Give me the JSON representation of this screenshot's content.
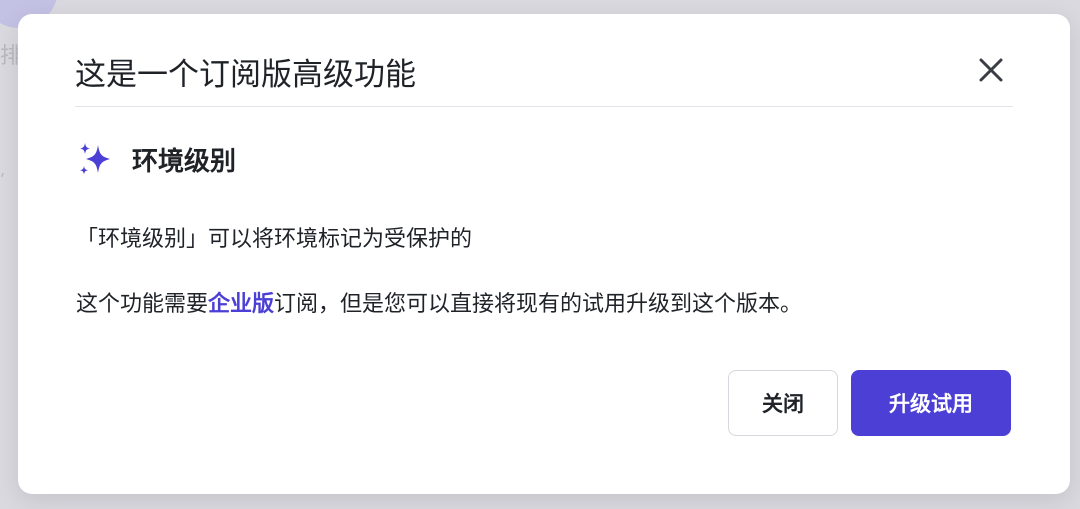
{
  "background": {
    "partial_text": "排",
    "partial_mark": ","
  },
  "dialog": {
    "title": "这是一个订阅版高级功能",
    "close_icon": "close-icon",
    "feature": {
      "icon": "sparkle-icon",
      "name": "环境级别"
    },
    "description": "「环境级别」可以将环境标记为受保护的",
    "upgrade_message": {
      "prefix": "这个功能需要",
      "plan_link": "企业版",
      "suffix": "订阅，但是您可以直接将现有的试用升级到这个版本。"
    },
    "buttons": {
      "close_label": "关闭",
      "upgrade_label": "升级试用"
    }
  },
  "colors": {
    "accent": "#4b3fd6",
    "overlay": "#d9d9df",
    "text": "#1f2328"
  }
}
